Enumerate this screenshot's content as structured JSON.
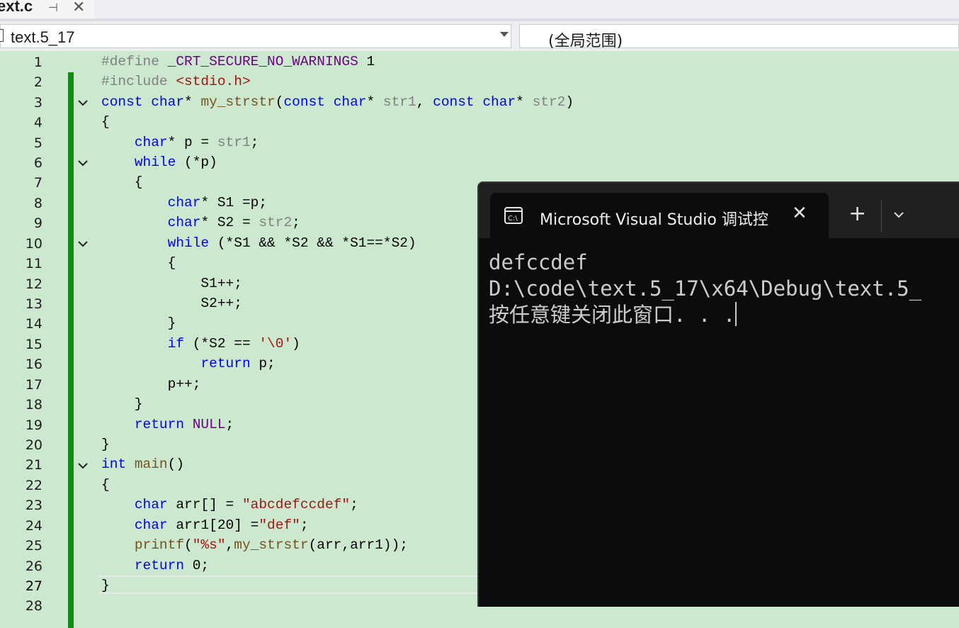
{
  "tab": {
    "title": "ext.c",
    "pin_icon": "pin-icon",
    "close_icon": "close-icon"
  },
  "navbar": {
    "file": "text.5_17",
    "scope": "(全局范围)"
  },
  "editor": {
    "current_line": 27,
    "line_numbers": [
      "1",
      "2",
      "3",
      "4",
      "5",
      "6",
      "7",
      "8",
      "9",
      "10",
      "11",
      "12",
      "13",
      "14",
      "15",
      "16",
      "17",
      "18",
      "19",
      "20",
      "21",
      "22",
      "23",
      "24",
      "25",
      "26",
      "27",
      "28"
    ]
  },
  "terminal": {
    "title": "Microsoft Visual Studio 调试控",
    "plus": "+",
    "output": [
      "defccdef",
      "D:\\code\\text.5_17\\x64\\Debug\\text.5_",
      "按任意键关闭此窗口. . ."
    ]
  }
}
